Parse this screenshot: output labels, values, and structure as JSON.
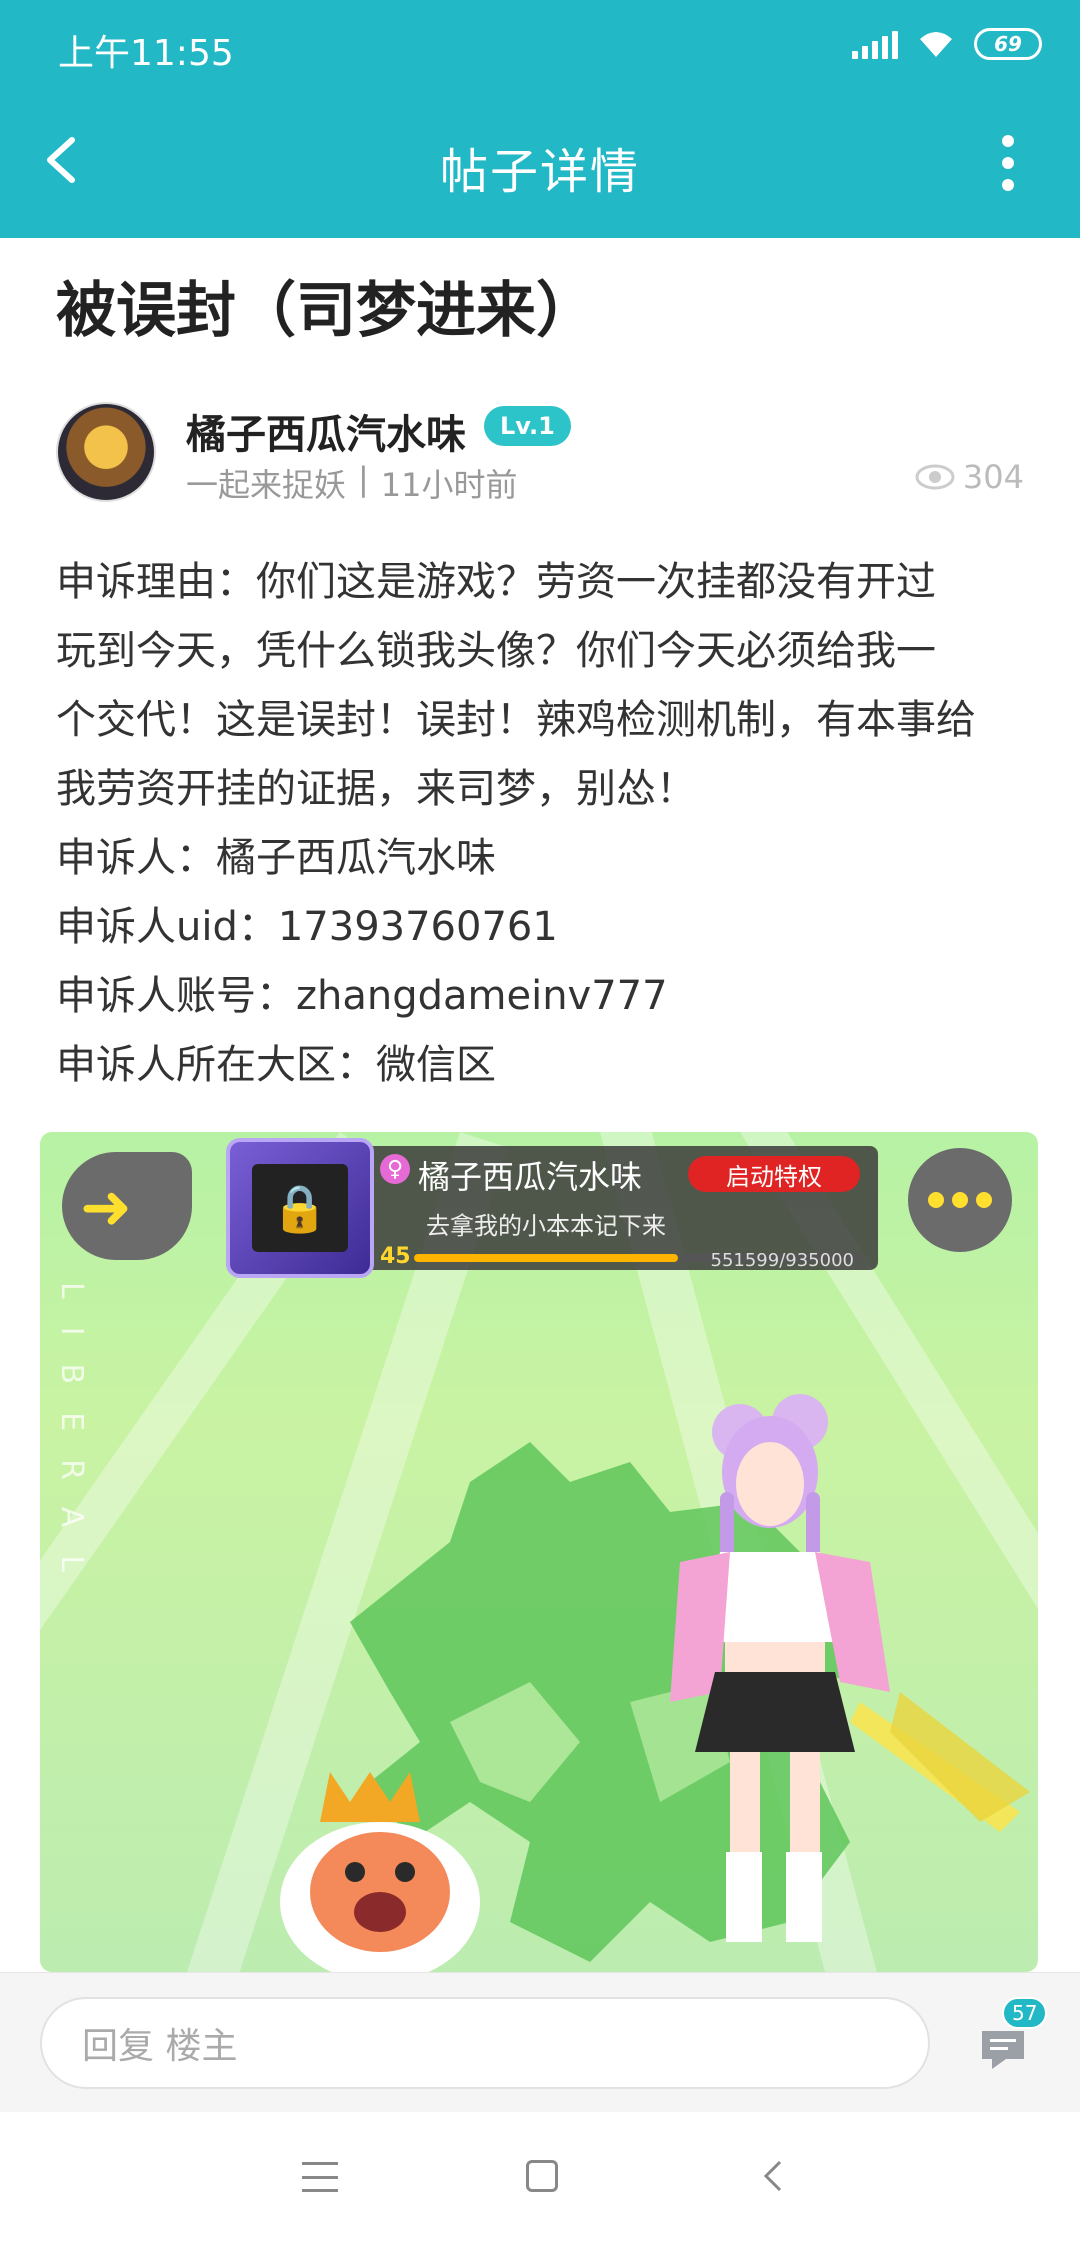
{
  "status_bar": {
    "time": "上午11:55",
    "battery": "69"
  },
  "header": {
    "title": "帖子详情"
  },
  "post": {
    "title": "被误封（司梦进来）",
    "author": {
      "name": "橘子西瓜汽水味",
      "level": "Lv.1",
      "group": "一起来捉妖",
      "separator": "|",
      "time": "11小时前"
    },
    "views": "304",
    "body": [
      "申诉理由：你们这是游戏？劳资一次挂都没有开过",
      "玩到今天，凭什么锁我头像？你们今天必须给我一",
      "个交代！这是误封！误封！辣鸡检测机制，有本事给",
      "我劳资开挂的证据，来司梦，别怂！",
      "申诉人：橘子西瓜汽水味",
      "申诉人uid：17393760761",
      "申诉人账号：zhangdameinv777",
      "申诉人所在大区：微信区"
    ]
  },
  "image": {
    "player_name": "橘子西瓜汽水味",
    "privilege_button": "启动特权",
    "signature": "去拿我的小本本记下来",
    "level": "45",
    "xp": "551599/935000",
    "xp_progress": 0.59,
    "side_text": "LIBERAL"
  },
  "reply_bar": {
    "placeholder": "回复  楼主",
    "comment_count": "57"
  }
}
